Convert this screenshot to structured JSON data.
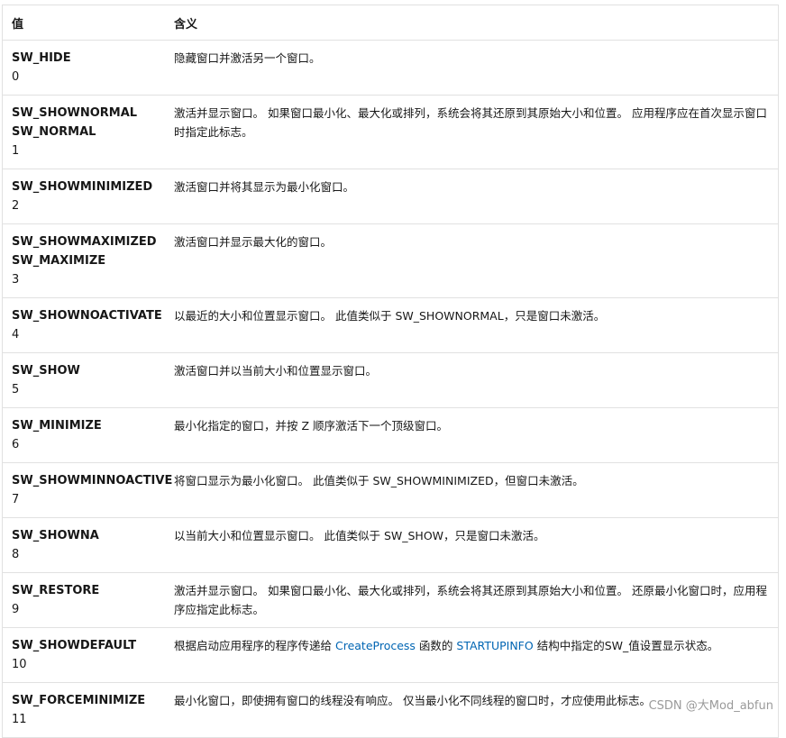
{
  "table": {
    "headers": {
      "value": "值",
      "meaning": "含义"
    },
    "rows": [
      {
        "names": [
          "SW_HIDE"
        ],
        "value": "0",
        "desc": [
          {
            "t": "隐藏窗口并激活另一个窗口。"
          }
        ]
      },
      {
        "names": [
          "SW_SHOWNORMAL",
          "SW_NORMAL"
        ],
        "value": "1",
        "desc": [
          {
            "t": "激活并显示窗口。 如果窗口最小化、最大化或排列，系统会将其还原到其原始大小和位置。 应用程序应在首次显示窗口时指定此标志。"
          }
        ]
      },
      {
        "names": [
          "SW_SHOWMINIMIZED"
        ],
        "value": "2",
        "desc": [
          {
            "t": "激活窗口并将其显示为最小化窗口。"
          }
        ]
      },
      {
        "names": [
          "SW_SHOWMAXIMIZED",
          "SW_MAXIMIZE"
        ],
        "value": "3",
        "desc": [
          {
            "t": "激活窗口并显示最大化的窗口。"
          }
        ]
      },
      {
        "names": [
          "SW_SHOWNOACTIVATE"
        ],
        "value": "4",
        "desc": [
          {
            "t": "以最近的大小和位置显示窗口。 此值类似于 SW_SHOWNORMAL，只是窗口未激活。"
          }
        ]
      },
      {
        "names": [
          "SW_SHOW"
        ],
        "value": "5",
        "desc": [
          {
            "t": "激活窗口并以当前大小和位置显示窗口。"
          }
        ]
      },
      {
        "names": [
          "SW_MINIMIZE"
        ],
        "value": "6",
        "desc": [
          {
            "t": "最小化指定的窗口，并按 Z 顺序激活下一个顶级窗口。"
          }
        ]
      },
      {
        "names": [
          "SW_SHOWMINNOACTIVE"
        ],
        "value": "7",
        "desc": [
          {
            "t": "将窗口显示为最小化窗口。 此值类似于 SW_SHOWMINIMIZED，但窗口未激活。"
          }
        ]
      },
      {
        "names": [
          "SW_SHOWNA"
        ],
        "value": "8",
        "desc": [
          {
            "t": "以当前大小和位置显示窗口。 此值类似于 SW_SHOW，只是窗口未激活。"
          }
        ]
      },
      {
        "names": [
          "SW_RESTORE"
        ],
        "value": "9",
        "desc": [
          {
            "t": "激活并显示窗口。 如果窗口最小化、最大化或排列，系统会将其还原到其原始大小和位置。 还原最小化窗口时，应用程序应指定此标志。"
          }
        ]
      },
      {
        "names": [
          "SW_SHOWDEFAULT"
        ],
        "value": "10",
        "desc": [
          {
            "t": "根据启动应用程序的程序传递给 "
          },
          {
            "t": "CreateProcess",
            "link": true
          },
          {
            "t": " 函数的 "
          },
          {
            "t": "STARTUPINFO",
            "link": true
          },
          {
            "t": " 结构中指定的SW_值设置显示状态。"
          }
        ]
      },
      {
        "names": [
          "SW_FORCEMINIMIZE"
        ],
        "value": "11",
        "desc": [
          {
            "t": "最小化窗口，即使拥有窗口的线程没有响应。 仅当最小化不同线程的窗口时，才应使用此标志。"
          }
        ]
      }
    ]
  },
  "watermark": "CSDN @大Mod_abfun"
}
